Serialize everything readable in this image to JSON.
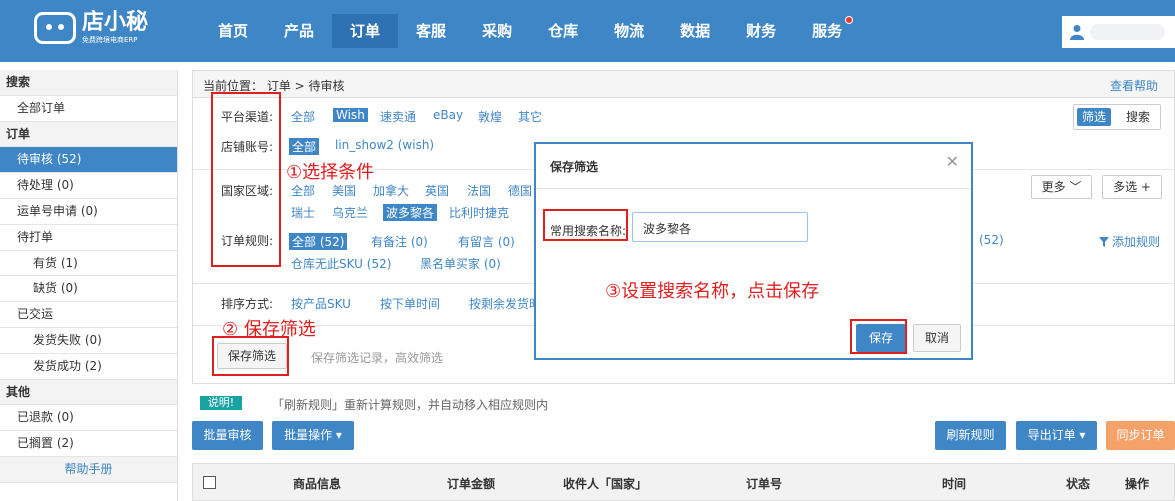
{
  "app": {
    "logo_main": "店小秘",
    "logo_sub": "免费跨境电商ERP"
  },
  "nav": [
    "首页",
    "产品",
    "订单",
    "客服",
    "采购",
    "仓库",
    "物流",
    "数据",
    "财务",
    "服务"
  ],
  "sidebar": [
    {
      "label": "搜索",
      "kind": "sec"
    },
    {
      "label": "全部订单",
      "kind": "item"
    },
    {
      "label": "订单",
      "kind": "sec"
    },
    {
      "label": "待审核  (52)",
      "kind": "item",
      "active": true
    },
    {
      "label": "待处理  (0)",
      "kind": "item"
    },
    {
      "label": "运单号申请  (0)",
      "kind": "item"
    },
    {
      "label": "待打单",
      "kind": "item"
    },
    {
      "label": "有货  (1)",
      "kind": "sub"
    },
    {
      "label": "缺货  (0)",
      "kind": "sub"
    },
    {
      "label": "已交运",
      "kind": "item"
    },
    {
      "label": "发货失败  (0)",
      "kind": "sub"
    },
    {
      "label": "发货成功  (2)",
      "kind": "sub"
    },
    {
      "label": "其他",
      "kind": "sec"
    },
    {
      "label": "已退款  (0)",
      "kind": "item"
    },
    {
      "label": "已搁置  (2)",
      "kind": "item"
    },
    {
      "label": "帮助手册",
      "kind": "help"
    }
  ],
  "breadcrumb": "当前位置： 订单 > 待审核",
  "help_link": "查看帮助",
  "filters": {
    "platform_label": "平台渠道:",
    "platform_options": [
      "全部",
      "Wish",
      "速卖通",
      "eBay",
      "敦煌",
      "其它"
    ],
    "store_label": "店铺账号:",
    "store_options": [
      "全部",
      "lin_show2 (wish)"
    ],
    "country_label": "国家区域:",
    "country_row1": [
      "全部",
      "美国",
      "加拿大",
      "英国",
      "法国",
      "德国"
    ],
    "country_row2": [
      "瑞士",
      "乌克兰",
      "波多黎各",
      "比利时",
      "捷克"
    ],
    "rule_label": "订单规则:",
    "rule_row1": [
      "全部 (52)",
      "有备注 (0)",
      "有留言 (0)"
    ],
    "rule_row2": [
      "仓库无此SKU (52)",
      "黑名单买家 (0)"
    ],
    "rule_right": "(52)",
    "add_rule": "添加规则",
    "sort_label": "排序方式:",
    "sort_options": [
      "按产品SKU",
      "按下单时间",
      "按剩余发货时"
    ]
  },
  "filter_tabs": [
    "筛选",
    "搜索"
  ],
  "more_btn": "更多",
  "multi_btn": "多选 +",
  "save_filter_btn": "保存筛选",
  "save_filter_hint": "保存筛选记录，高效筛选",
  "annotations": {
    "a1": "①选择条件",
    "a2": "② 保存筛选",
    "a3": "③设置搜索名称，点击保存"
  },
  "modal": {
    "title": "保存筛选",
    "field_label": "常用搜索名称:",
    "field_value": "波多黎各",
    "save": "保存",
    "cancel": "取消"
  },
  "info_tag": "说明!",
  "info_text": "「刷新规则」重新计算规则，并自动移入相应规则内",
  "actions": {
    "bulk_review": "批量审核",
    "bulk_ops": "批量操作 ▾",
    "refresh_rule": "刷新规则",
    "export": "导出订单 ▾",
    "sync": "同步订单"
  },
  "table_headers": [
    "商品信息",
    "订单金额",
    "收件人「国家」",
    "订单号",
    "时间",
    "状态",
    "操作"
  ]
}
